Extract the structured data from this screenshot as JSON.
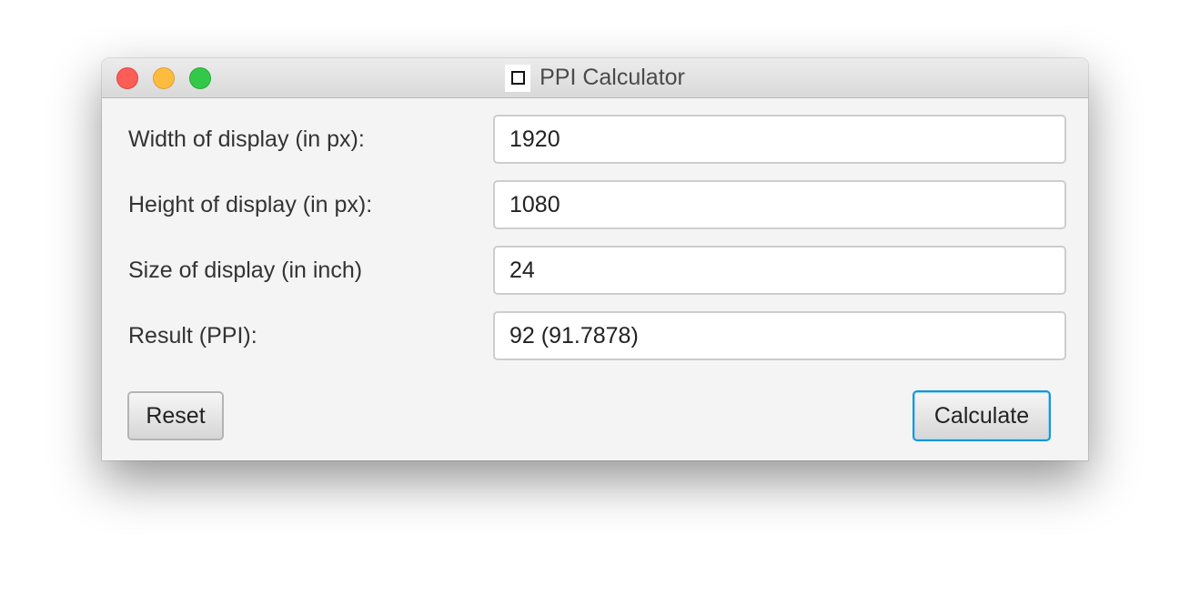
{
  "window": {
    "title": "PPI Calculator",
    "controls": [
      "close",
      "minimize",
      "maximize"
    ],
    "icon": "blank-app-icon"
  },
  "form": {
    "width": {
      "label": "Width of display (in px):",
      "value": "1920"
    },
    "height": {
      "label": "Height of display (in px):",
      "value": "1080"
    },
    "size": {
      "label": "Size of display (in inch)",
      "value": "24"
    },
    "result": {
      "label": "Result (PPI):",
      "value": "92 (91.7878)"
    }
  },
  "buttons": {
    "reset": "Reset",
    "calculate": "Calculate"
  },
  "colors": {
    "close": "#fc5d57",
    "minimize": "#fdbc40",
    "maximize": "#34c84a",
    "focus_ring": "#1596d9"
  }
}
